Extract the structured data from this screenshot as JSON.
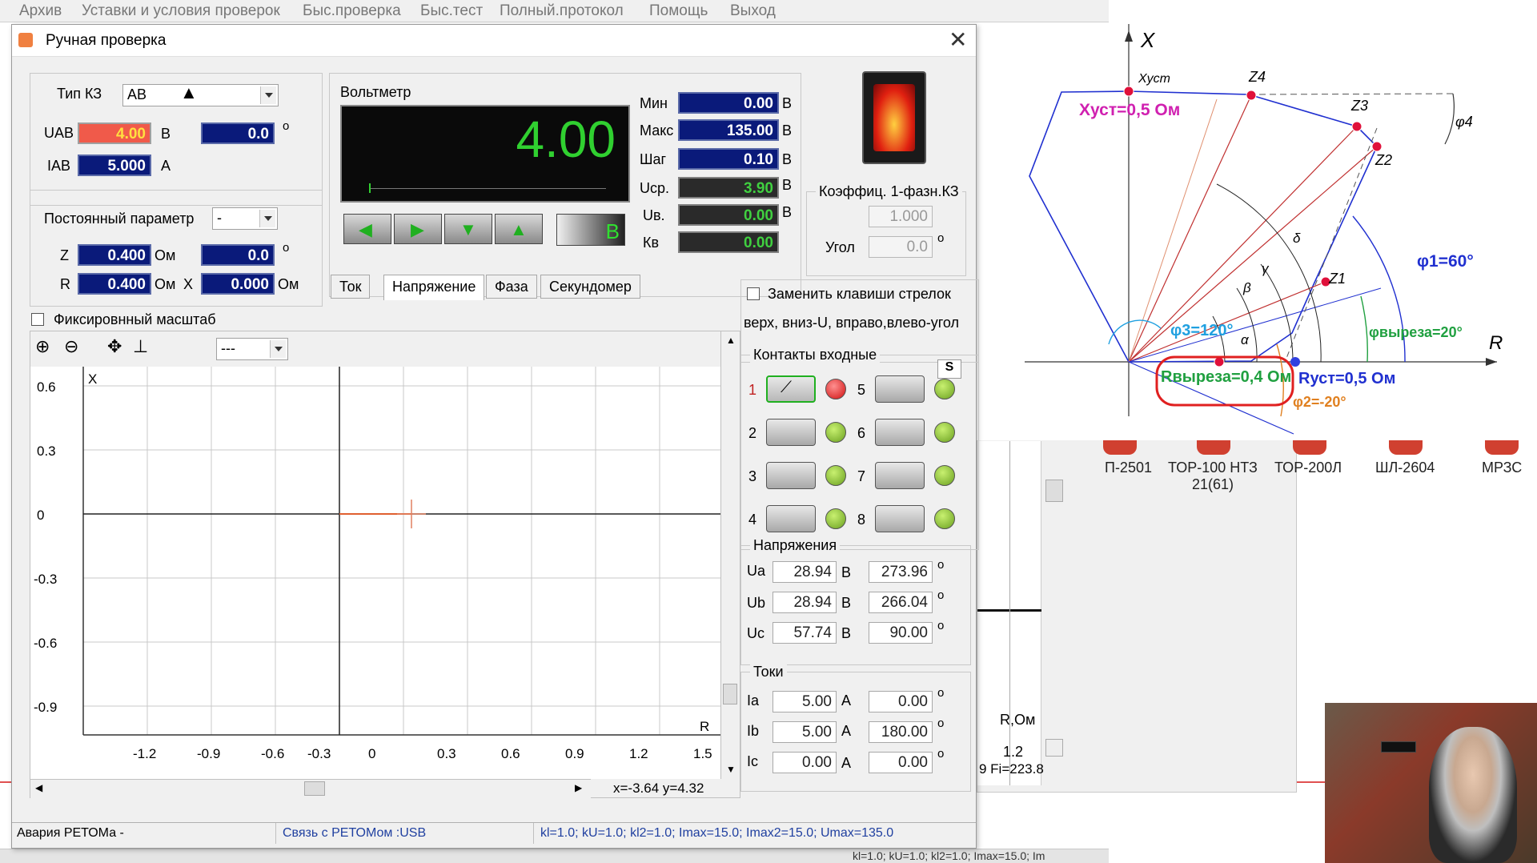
{
  "menu": [
    "Архив",
    "Уставки и условия проверок",
    "Быс.проверка",
    "Быс.тест",
    "Полный.протокол",
    "Помощь",
    "Выход"
  ],
  "dialog": {
    "title": "Ручная проверка",
    "kz_type_label": "Тип КЗ",
    "kz_type_value": "АВ",
    "uab_label": "UAB",
    "uab_value": "4.00",
    "uab_unit": "В",
    "uab_angle": "0.0",
    "iab_label": "IAB",
    "iab_value": "5.000",
    "iab_unit": "А",
    "deg": "о",
    "const_param_label": "Постоянный параметр",
    "const_param_value": "-",
    "z_label": "Z",
    "z_value": "0.400",
    "z_unit": "Ом",
    "z_angle": "0.0",
    "r_label": "R",
    "r_value": "0.400",
    "r_unit": "Ом",
    "x_label": "X",
    "x_value": "0.000",
    "x_unit": "Ом",
    "fixed_scale_label": "Фиксировнный масштаб",
    "voltmeter": {
      "title": "Вольтметр",
      "display": "4.00",
      "unit_btn": "В",
      "min_label": "Мин",
      "min_value": "0.00",
      "max_label": "Макс",
      "max_value": "135.00",
      "step_label": "Шаг",
      "step_value": "0.10",
      "ucp_label": "Uср.",
      "ucp_value": "3.90",
      "uv_label": "Uв.",
      "uv_value": "0.00",
      "kv_label": "Кв",
      "kv_value": "0.00",
      "unit": "В"
    },
    "coef": {
      "title": "Коэффиц. 1-фазн.КЗ",
      "value": "1.000",
      "angle_label": "Угол",
      "angle_value": "0.0"
    },
    "tabs": [
      "Ток",
      "Напряжение",
      "Фаза",
      "Секундомер"
    ],
    "replace_keys_label": "Заменить клавиши стрелок",
    "replace_keys_hint": "верх, вниз-U, вправо,влево-угол",
    "contacts": {
      "title": "Контакты входные",
      "s_label": "S",
      "numbers": [
        "1",
        "2",
        "3",
        "4",
        "5",
        "6",
        "7",
        "8"
      ]
    },
    "voltages": {
      "title": "Напряжения",
      "rows": [
        {
          "label": "Ua",
          "value": "28.94",
          "unit": "В",
          "angle": "273.96"
        },
        {
          "label": "Ub",
          "value": "28.94",
          "unit": "В",
          "angle": "266.04"
        },
        {
          "label": "Uc",
          "value": "57.74",
          "unit": "В",
          "angle": "90.00"
        }
      ]
    },
    "currents": {
      "title": "Токи",
      "rows": [
        {
          "label": "Ia",
          "value": "5.00",
          "unit": "А",
          "angle": "0.00"
        },
        {
          "label": "Ib",
          "value": "5.00",
          "unit": "А",
          "angle": "180.00"
        },
        {
          "label": "Ic",
          "value": "0.00",
          "unit": "А",
          "angle": "0.00"
        }
      ]
    },
    "plot": {
      "y_ticks": [
        "0.6",
        "0.3",
        "0",
        "-0.3",
        "-0.6",
        "-0.9"
      ],
      "x_ticks": [
        "-1.2",
        "-0.9",
        "-0.6",
        "-0.3",
        "0",
        "0.3",
        "0.6",
        "0.9",
        "1.2",
        "1.5"
      ],
      "x_axis_label": "R",
      "y_axis_label": "X",
      "combo_value": "---",
      "coords": "x=-3.64 y=4.32"
    },
    "status": [
      "Авария РЕТОМа -",
      "Связь с РЕТОМом :USB",
      "kl=1.0; kU=1.0; kl2=1.0; Imax=15.0; Imax2=15.0; Umax=135.0"
    ]
  },
  "diagram": {
    "x_axis": "X",
    "r_axis": "R",
    "x_ust_point": "Xуст",
    "x_ust": "Xуст=0,5 Ом",
    "r_ust": "Rуст=0,5 Ом",
    "r_cut": "Rвыреза=0,4 Ом",
    "phi1": "φ1=60°",
    "phi2": "φ2=-20°",
    "phi3": "φ3=120°",
    "phi4": "φ4",
    "phi_cut": "φвыреза=20°",
    "z1": "Z1",
    "z2": "Z2",
    "z3": "Z3",
    "z4": "Z4",
    "alpha": "α",
    "beta": "β",
    "gamma": "γ",
    "delta": "δ"
  },
  "background": {
    "apps": [
      "П-2501",
      "ТОР-100 НТЗ 21(61)",
      "ТОР-200Л",
      "ШЛ-2604",
      "МРЗС"
    ],
    "r_om_label": "R,Ом",
    "tick_12": "1.2",
    "fi_label": "9 Fi=223.8",
    "bottom_status": "kl=1.0; kU=1.0; kl2=1.0; Imax=15.0; Im"
  }
}
